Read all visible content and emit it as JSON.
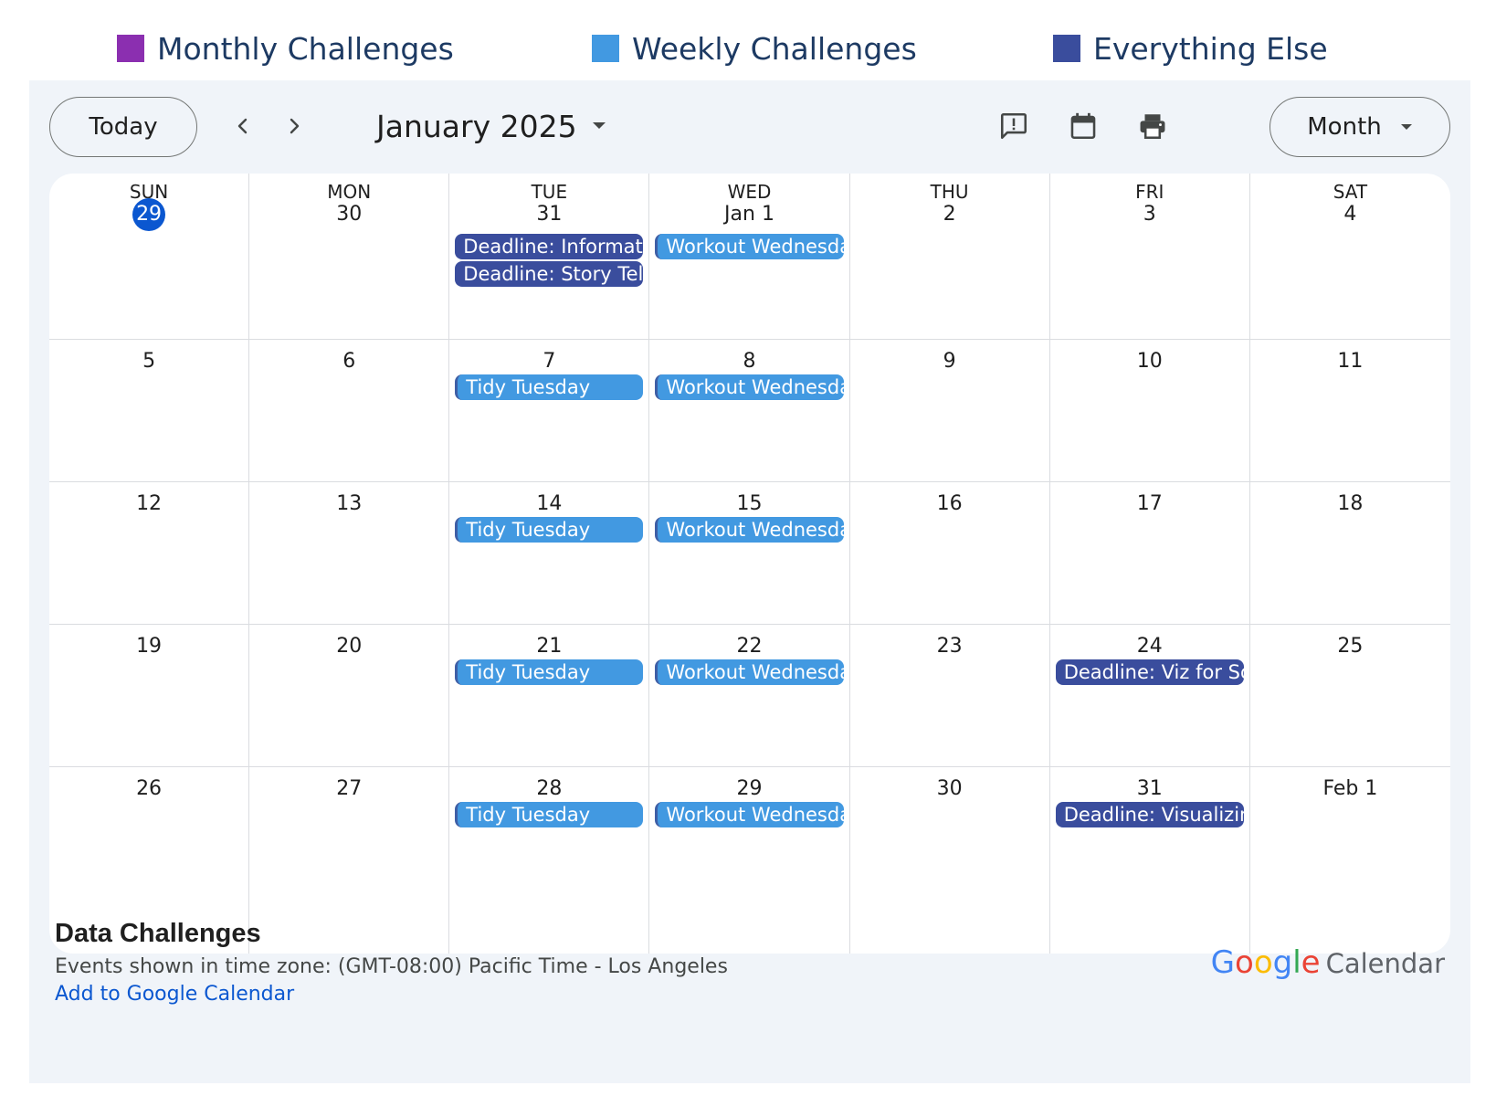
{
  "legend": [
    {
      "label": "Monthly Challenges",
      "color": "#8b2fb0"
    },
    {
      "label": "Weekly Challenges",
      "color": "#4299e1"
    },
    {
      "label": "Everything Else",
      "color": "#3a4d9d"
    }
  ],
  "toolbar": {
    "today_label": "Today",
    "prev_icon": "chevron-left-icon",
    "next_icon": "chevron-right-icon",
    "month_title": "January 2025",
    "feedback_icon": "feedback-icon",
    "calendar_icon": "calendar-icon",
    "print_icon": "print-icon",
    "view_label": "Month"
  },
  "calendar": {
    "weekdays": [
      "SUN",
      "MON",
      "TUE",
      "WED",
      "THU",
      "FRI",
      "SAT"
    ],
    "today_color": "#0b57d0",
    "weeks": [
      [
        {
          "day": "29",
          "today": true,
          "events": []
        },
        {
          "day": "30",
          "events": []
        },
        {
          "day": "31",
          "events": [
            {
              "title": "Deadline: Information is Beautiful",
              "category": "else"
            },
            {
              "title": "Deadline: Story Telling",
              "category": "else"
            }
          ]
        },
        {
          "day": "Jan 1",
          "events": [
            {
              "title": "Workout Wednesday",
              "category": "weekly"
            }
          ]
        },
        {
          "day": "2",
          "events": []
        },
        {
          "day": "3",
          "events": []
        },
        {
          "day": "4",
          "events": []
        }
      ],
      [
        {
          "day": "5",
          "events": []
        },
        {
          "day": "6",
          "events": []
        },
        {
          "day": "7",
          "events": [
            {
              "title": "Tidy Tuesday",
              "category": "weekly"
            }
          ]
        },
        {
          "day": "8",
          "events": [
            {
              "title": "Workout Wednesday",
              "category": "weekly"
            }
          ]
        },
        {
          "day": "9",
          "events": []
        },
        {
          "day": "10",
          "events": []
        },
        {
          "day": "11",
          "events": []
        }
      ],
      [
        {
          "day": "12",
          "events": []
        },
        {
          "day": "13",
          "events": []
        },
        {
          "day": "14",
          "events": [
            {
              "title": "Tidy Tuesday",
              "category": "weekly"
            }
          ]
        },
        {
          "day": "15",
          "events": [
            {
              "title": "Workout Wednesday",
              "category": "weekly"
            }
          ]
        },
        {
          "day": "16",
          "events": []
        },
        {
          "day": "17",
          "events": []
        },
        {
          "day": "18",
          "events": []
        }
      ],
      [
        {
          "day": "19",
          "events": []
        },
        {
          "day": "20",
          "events": []
        },
        {
          "day": "21",
          "events": [
            {
              "title": "Tidy Tuesday",
              "category": "weekly"
            }
          ]
        },
        {
          "day": "22",
          "events": [
            {
              "title": "Workout Wednesday",
              "category": "weekly"
            }
          ]
        },
        {
          "day": "23",
          "events": []
        },
        {
          "day": "24",
          "events": [
            {
              "title": "Deadline: Viz for Social Good",
              "category": "else"
            }
          ]
        },
        {
          "day": "25",
          "events": []
        }
      ],
      [
        {
          "day": "26",
          "events": []
        },
        {
          "day": "27",
          "events": []
        },
        {
          "day": "28",
          "events": [
            {
              "title": "Tidy Tuesday",
              "category": "weekly"
            }
          ]
        },
        {
          "day": "29",
          "events": [
            {
              "title": "Workout Wednesday",
              "category": "weekly"
            }
          ]
        },
        {
          "day": "30",
          "events": []
        },
        {
          "day": "31",
          "events": [
            {
              "title": "Deadline: Visualizing",
              "category": "else"
            }
          ]
        },
        {
          "day": "Feb 1",
          "events": []
        }
      ]
    ]
  },
  "footer": {
    "calendar_name": "Data Challenges",
    "timezone": "Events shown in time zone: (GMT-08:00) Pacific Time - Los Angeles",
    "add_link": "Add to Google Calendar",
    "logo_word": "Google",
    "logo_colors": [
      "#4285f4",
      "#ea4335",
      "#fbbc05",
      "#4285f4",
      "#34a853",
      "#ea4335"
    ],
    "logo_suffix": "Calendar"
  }
}
